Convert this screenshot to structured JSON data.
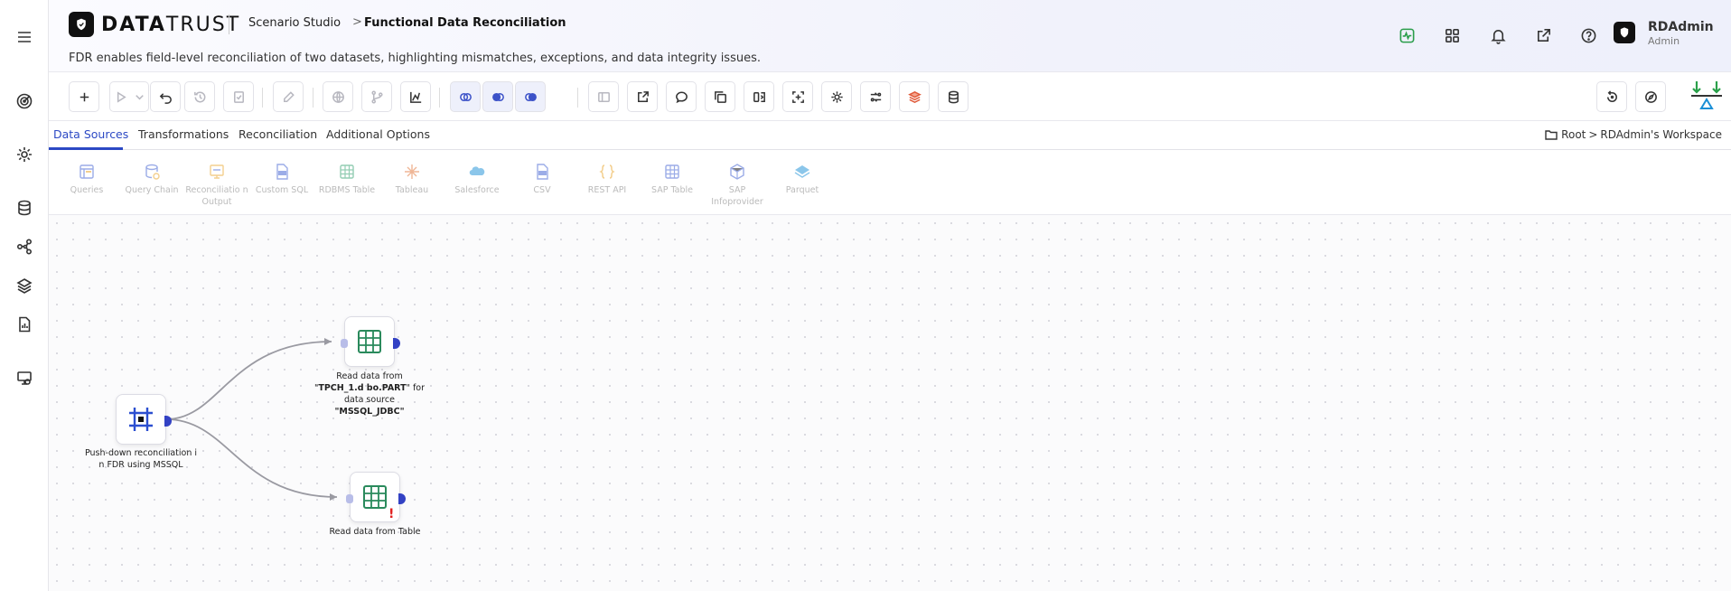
{
  "app": {
    "logo_bold": "DATA",
    "logo_light": "TRUST",
    "breadcrumb_parent": "Scenario Studio",
    "breadcrumb_separator": ">",
    "breadcrumb_current": "Functional Data Reconciliation",
    "description": "FDR enables field-level reconciliation of two datasets, highlighting mismatches, exceptions, and data integrity issues."
  },
  "rail": {
    "icons": [
      "menu-icon",
      "target-icon",
      "gear-icon",
      "database-icon",
      "graph-icon",
      "layers-icon",
      "report-icon",
      "monitor-icon"
    ]
  },
  "header_icons": [
    "activity-icon",
    "apps-grid-icon",
    "bell-icon",
    "external-link-icon",
    "help-icon"
  ],
  "user": {
    "name": "RDAdmin",
    "role": "Admin"
  },
  "tabs": [
    {
      "label": "Data Sources",
      "active": true
    },
    {
      "label": "Transformations",
      "active": false
    },
    {
      "label": "Reconciliation",
      "active": false
    },
    {
      "label": "Additional Options",
      "active": false
    }
  ],
  "workspace_path": {
    "root": "Root",
    "separator": ">",
    "workspace": "RDAdmin's Workspace"
  },
  "palette": [
    {
      "label": "Queries",
      "icon": "queries-icon",
      "color": "#3a5bd0"
    },
    {
      "label": "Query Chain",
      "icon": "query-chain-icon",
      "color": "#3a5bd0"
    },
    {
      "label": "Reconciliatio n Output",
      "icon": "reconciliation-output-icon",
      "color": "#e8a020"
    },
    {
      "label": "Custom SQL",
      "icon": "custom-sql-icon",
      "color": "#3a5bd0"
    },
    {
      "label": "RDBMS Table",
      "icon": "rdbms-table-icon",
      "color": "#2a9d6a"
    },
    {
      "label": "Tableau",
      "icon": "tableau-icon",
      "color": "#e07030"
    },
    {
      "label": "Salesforce",
      "icon": "salesforce-icon",
      "color": "#1a8fd6"
    },
    {
      "label": "CSV",
      "icon": "csv-icon",
      "color": "#3a5bd0"
    },
    {
      "label": "REST API",
      "icon": "rest-api-icon",
      "color": "#e8a020"
    },
    {
      "label": "SAP Table",
      "icon": "sap-table-icon",
      "color": "#3a5bd0"
    },
    {
      "label": "SAP Infoprovider",
      "icon": "sap-infoprovider-icon",
      "color": "#3a5bd0"
    },
    {
      "label": "Parquet",
      "icon": "parquet-icon",
      "color": "#1a8fd6"
    }
  ],
  "nodes": {
    "pushdown": {
      "label": "Push-down reconciliation i n FDR using MSSQL"
    },
    "table1": {
      "label_prefix": "Read data from \"",
      "label_table": "TPCH_1.d bo.PART",
      "label_middle": "\" for data source ",
      "label_source": "\"MSSQL_JDBC\""
    },
    "table2": {
      "label": "Read data from Table",
      "warning": "!"
    }
  },
  "colors": {
    "accent": "#2c49c4",
    "node_green": "#2a8a5c",
    "node_blue": "#2c4fd0",
    "port_out": "#3342c4",
    "warning": "#e02020"
  }
}
